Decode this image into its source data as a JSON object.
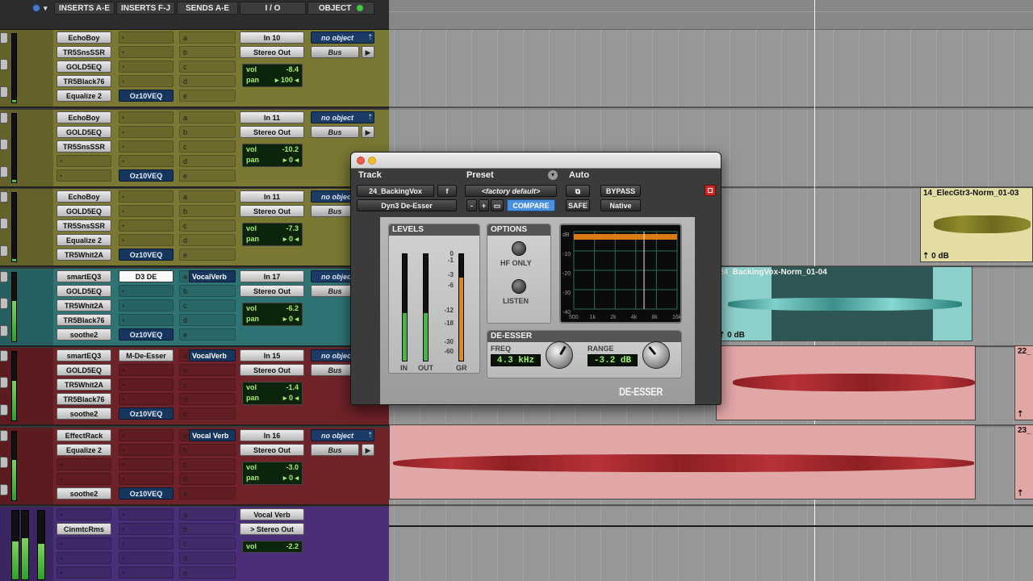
{
  "columns": {
    "inserts_ae": "INSERTS A-E",
    "inserts_fj": "INSERTS F-J",
    "sends_ae": "SENDS A-E",
    "io": "I / O",
    "object": "OBJECT"
  },
  "send_letters": [
    "a",
    "b",
    "c",
    "d",
    "e"
  ],
  "tracks": [
    {
      "inserts": [
        "EchoBoy",
        "TR5SnsSSR",
        "GOLD5EQ",
        "TR5Black76",
        "Equalize 2"
      ],
      "inserts_fj": [
        "",
        "",
        "",
        "",
        "Oz10VEQ"
      ],
      "sends": [
        "",
        "",
        "",
        "",
        ""
      ],
      "input": "In 10",
      "output": "Stereo Out",
      "vol": "-8.4",
      "pan": "100",
      "object": "no object",
      "bus": "Bus"
    },
    {
      "inserts": [
        "EchoBoy",
        "GOLD5EQ",
        "TR5SnsSSR",
        "",
        ""
      ],
      "inserts_fj": [
        "",
        "",
        "",
        "",
        "Oz10VEQ"
      ],
      "sends": [
        "",
        "",
        "",
        "",
        ""
      ],
      "input": "In 11",
      "output": "Stereo Out",
      "vol": "-10.2",
      "pan": "0",
      "object": "no object",
      "bus": "Bus"
    },
    {
      "inserts": [
        "EchoBoy",
        "GOLD5EQ",
        "TR5SnsSSR",
        "Equalize 2",
        "TR5Whit2A"
      ],
      "inserts_fj": [
        "",
        "",
        "",
        "",
        "Oz10VEQ"
      ],
      "sends": [
        "",
        "",
        "",
        "",
        ""
      ],
      "input": "In 11",
      "output": "Stereo Out",
      "vol": "-7.3",
      "pan": "0",
      "object": "no object",
      "bus": "Bus"
    },
    {
      "inserts": [
        "smartEQ3",
        "GOLD5EQ",
        "TR5Whit2A",
        "TR5Black76",
        "soothe2"
      ],
      "inserts_fj": [
        "D3 DE",
        "",
        "",
        "",
        "Oz10VEQ"
      ],
      "sends": [
        "VocalVerb",
        "",
        "",
        "",
        ""
      ],
      "input": "In 17",
      "output": "Stereo Out",
      "vol": "-6.2",
      "pan": "0",
      "object": "no object",
      "bus": "Bus"
    },
    {
      "inserts": [
        "smartEQ3",
        "GOLD5EQ",
        "TR5Whit2A",
        "TR5Black76",
        "soothe2"
      ],
      "inserts_fj": [
        "M-De-Esser",
        "",
        "",
        "",
        "Oz10VEQ"
      ],
      "sends": [
        "VocalVerb",
        "",
        "",
        "",
        ""
      ],
      "input": "In 15",
      "output": "Stereo Out",
      "vol": "-1.4",
      "pan": "0",
      "object": "no object",
      "bus": "Bus"
    },
    {
      "inserts": [
        "EffectRack",
        "Equalize 2",
        "",
        "",
        "soothe2"
      ],
      "inserts_fj": [
        "",
        "",
        "",
        "",
        "Oz10VEQ"
      ],
      "sends": [
        "Vocal Verb",
        "",
        "",
        "",
        ""
      ],
      "input": "In 16",
      "output": "Stereo Out",
      "vol": "-3.0",
      "pan": "0",
      "object": "no object",
      "bus": "Bus"
    },
    {
      "inserts": [
        "",
        "CinmtcRms",
        "",
        "",
        ""
      ],
      "inserts_fj": [
        "",
        "",
        "",
        "",
        ""
      ],
      "sends": [
        "",
        "",
        "",
        "",
        ""
      ],
      "input": "Vocal Verb",
      "output": "> Stereo Out",
      "vol": "-2.2",
      "pan": "",
      "object": "",
      "bus": ""
    }
  ],
  "labels": {
    "vol": "vol",
    "pan": "pan"
  },
  "colors": {
    "track_bg": [
      "#7b7834",
      "#7b7834",
      "#7b7834",
      "#2f7474",
      "#6f2227",
      "#6f2227",
      "#4a2f78"
    ],
    "plugin_accent": "#d97a12",
    "meter_green": "#2aa228",
    "lcd_text": "#9bf26b"
  },
  "clips": [
    {
      "name": "14_ElecGtr3-Norm_01-03",
      "gain": "0 dB"
    },
    {
      "name": "24_BackingVox-Norm_01-04",
      "gain": "0 dB"
    },
    {
      "name": "22_",
      "gain": ""
    },
    {
      "name": "23_",
      "gain": ""
    }
  ],
  "plugin": {
    "header": {
      "track": "Track",
      "preset": "Preset",
      "auto": "Auto"
    },
    "track_name": "24_BackingVox",
    "track_btn": "f",
    "insert_name": "Dyn3 De-Esser",
    "preset_name": "<factory default>",
    "preset_minus": "-",
    "preset_plus": "+",
    "compare": "COMPARE",
    "bypass": "BYPASS",
    "safe": "SAFE",
    "native": "Native",
    "levels_title": "LEVELS",
    "meter_in": "IN",
    "meter_out": "OUT",
    "meter_gr": "GR",
    "scale": [
      "0",
      "-1",
      "-3",
      "-6",
      "-12",
      "-18",
      "-30",
      "-60"
    ],
    "levels": {
      "in": 0.45,
      "out": 0.45,
      "gr": 0.78
    },
    "options_title": "OPTIONS",
    "hf_only": "HF ONLY",
    "listen": "LISTEN",
    "graph_y": [
      "dB",
      "-10",
      "-20",
      "-30",
      "-40"
    ],
    "graph_x": [
      "500",
      "1k",
      "2k",
      "4k",
      "8k",
      "16k"
    ],
    "deesser_title": "DE-ESSER",
    "freq_label": "FREQ",
    "freq_value": "4.3 kHz",
    "range_label": "RANGE",
    "range_value": "-3.2 dB",
    "logo": "DE-ESSER"
  }
}
